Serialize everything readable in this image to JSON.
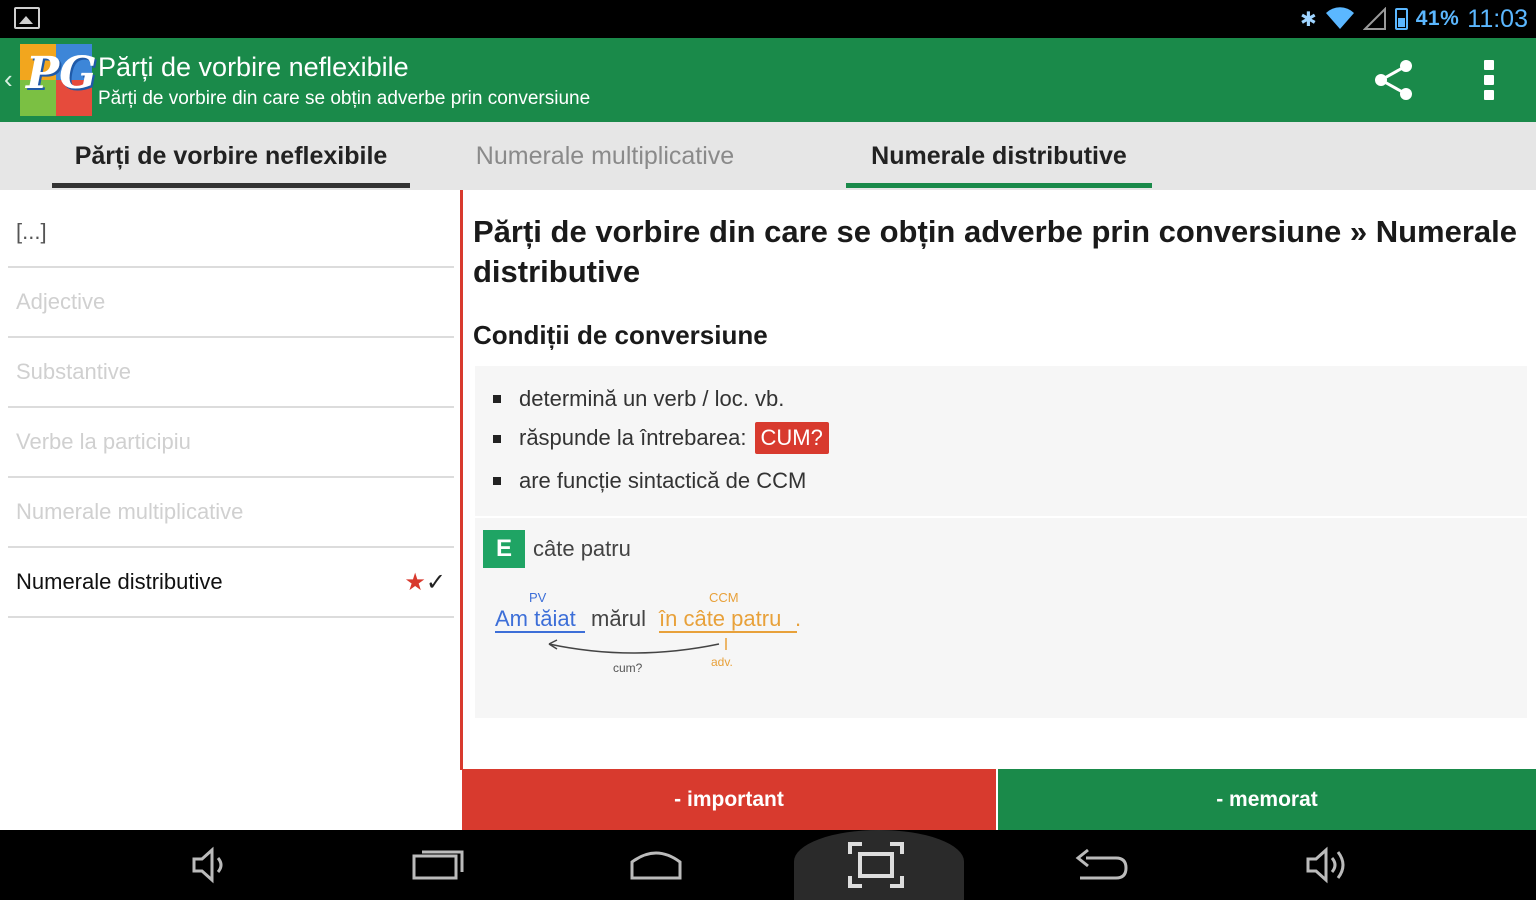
{
  "status_bar": {
    "battery_percent": "41%",
    "time": "11:03",
    "icons": [
      "gallery-icon",
      "bluetooth-icon",
      "wifi-icon",
      "signal-icon",
      "battery-icon"
    ]
  },
  "action_bar": {
    "title": "Părți de vorbire neflexibile",
    "subtitle": "Părți de vorbire din care se obțin adverbe prin conversiune",
    "logo_letters": "PG",
    "icons": [
      "back-chevron-icon",
      "app-logo",
      "share-icon",
      "overflow-menu-icon"
    ]
  },
  "tabs": [
    {
      "label": "Părți de vorbire neflexibile",
      "state": "selected-dark"
    },
    {
      "label": "Numerale multiplicative",
      "state": "inactive"
    },
    {
      "label": "Numerale distributive",
      "state": "selected-green"
    }
  ],
  "sidebar": {
    "items": [
      {
        "label": "[...]"
      },
      {
        "label": "Adjective"
      },
      {
        "label": "Substantive"
      },
      {
        "label": "Verbe la participiu"
      },
      {
        "label": "Numerale multiplicative"
      },
      {
        "label": "Numerale distributive",
        "active": true,
        "star": "★",
        "check": "✓"
      }
    ]
  },
  "content": {
    "title": "Părți de vorbire din care se obțin adverbe prin conversiune » Numerale distributive",
    "section_title": "Condiții de conversiune",
    "conditions": [
      {
        "text": "determină un verb / loc. vb."
      },
      {
        "text": "răspunde la întrebarea:",
        "highlight": "CUM?"
      },
      {
        "text": "are funcție sintactică de CCM"
      }
    ],
    "example": {
      "badge": "E",
      "text": "câte patru",
      "diagram": {
        "label_pv": "PV",
        "label_ccm": "CCM",
        "part_verb": "Am tăiat",
        "part_object": "mărul",
        "part_adverbial": "în câte patru",
        "period": ".",
        "question": "cum?",
        "note": "adv."
      }
    }
  },
  "buttons": {
    "important": "- important",
    "memorat": "- memorat"
  },
  "colors": {
    "green": "#1a8a4a",
    "red": "#d83a2e",
    "blue_accent": "#5bb7ff"
  },
  "nav_bar": {
    "icons": [
      "volume-down-icon",
      "recent-apps-icon",
      "home-icon",
      "screenshot-icon",
      "back-icon",
      "volume-up-icon"
    ]
  }
}
